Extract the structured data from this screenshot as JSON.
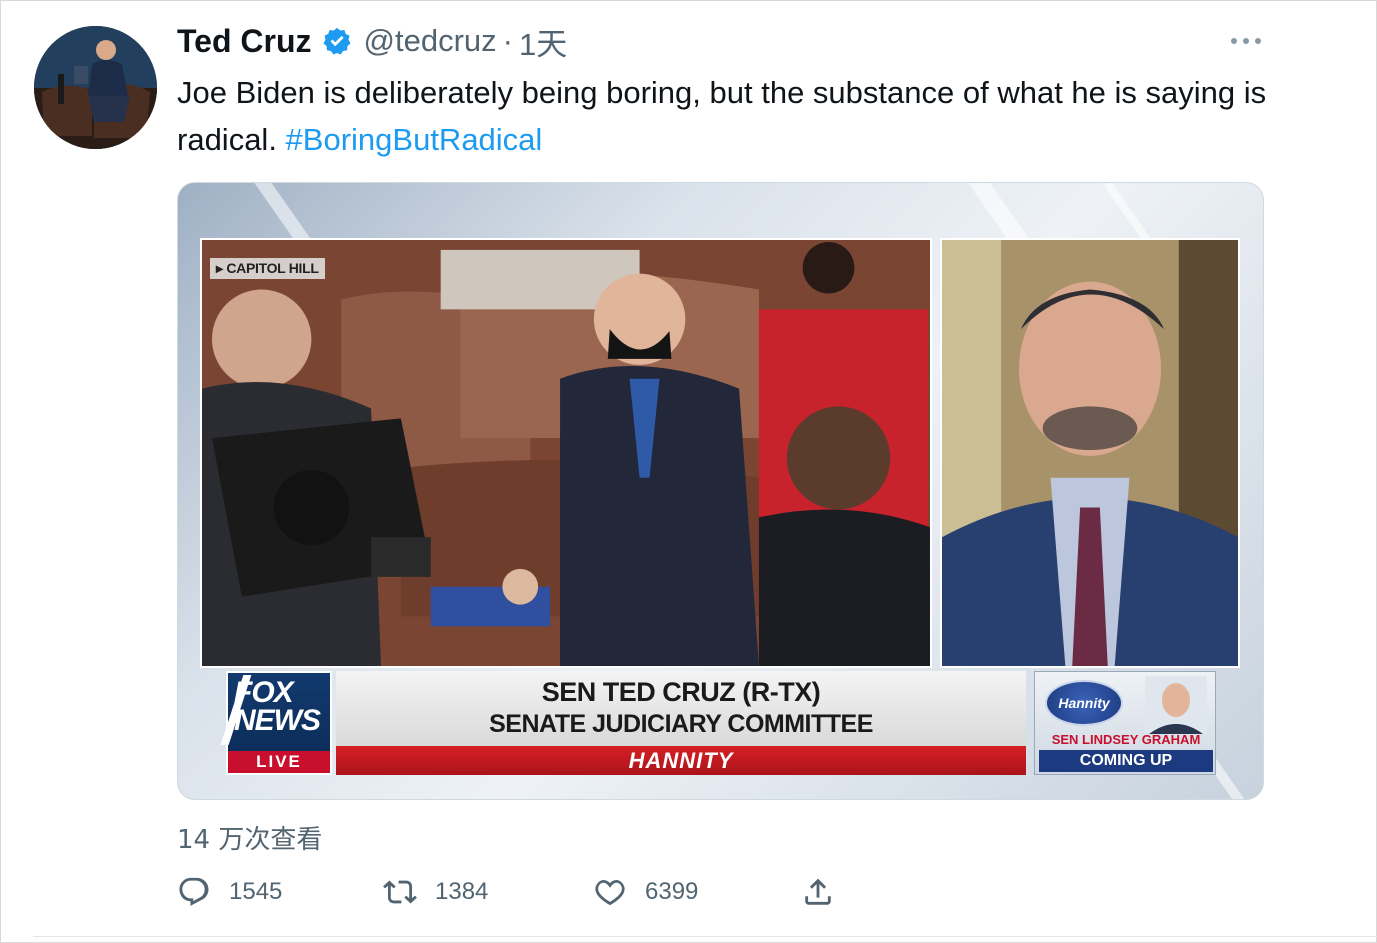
{
  "tweet": {
    "author_name": "Ted Cruz",
    "handle": "@tedcruz",
    "separator": "·",
    "time": "1天",
    "text_main": "Joe Biden is deliberately being boring, but the substance of what he is saying is radical. ",
    "hashtag": "#BoringButRadical",
    "views": "14 万次查看",
    "replies": "1545",
    "retweets": "1384",
    "likes": "6399"
  },
  "media": {
    "location_tag": "▸ CAPITOL HILL",
    "fox_word_1": "FOX",
    "fox_word_2": "NEWS",
    "fox_live": "LIVE",
    "banner_line1": "SEN TED CRUZ (R-TX)",
    "banner_line2": "SENATE JUDICIARY COMMITTEE",
    "banner_show": "HANNITY",
    "teaser_badge": "Hannity",
    "teaser_name": "SEN LINDSEY GRAHAM",
    "teaser_coming": "COMING UP"
  },
  "icons": {
    "verified": "verified-badge-icon",
    "more": "more-options-icon",
    "reply": "reply-icon",
    "retweet": "retweet-icon",
    "like": "like-icon",
    "share": "share-icon"
  },
  "colors": {
    "accent": "#1d9bf0",
    "secondary_text": "#536471",
    "fox_red": "#c8102e",
    "fox_blue": "#123a6e"
  }
}
